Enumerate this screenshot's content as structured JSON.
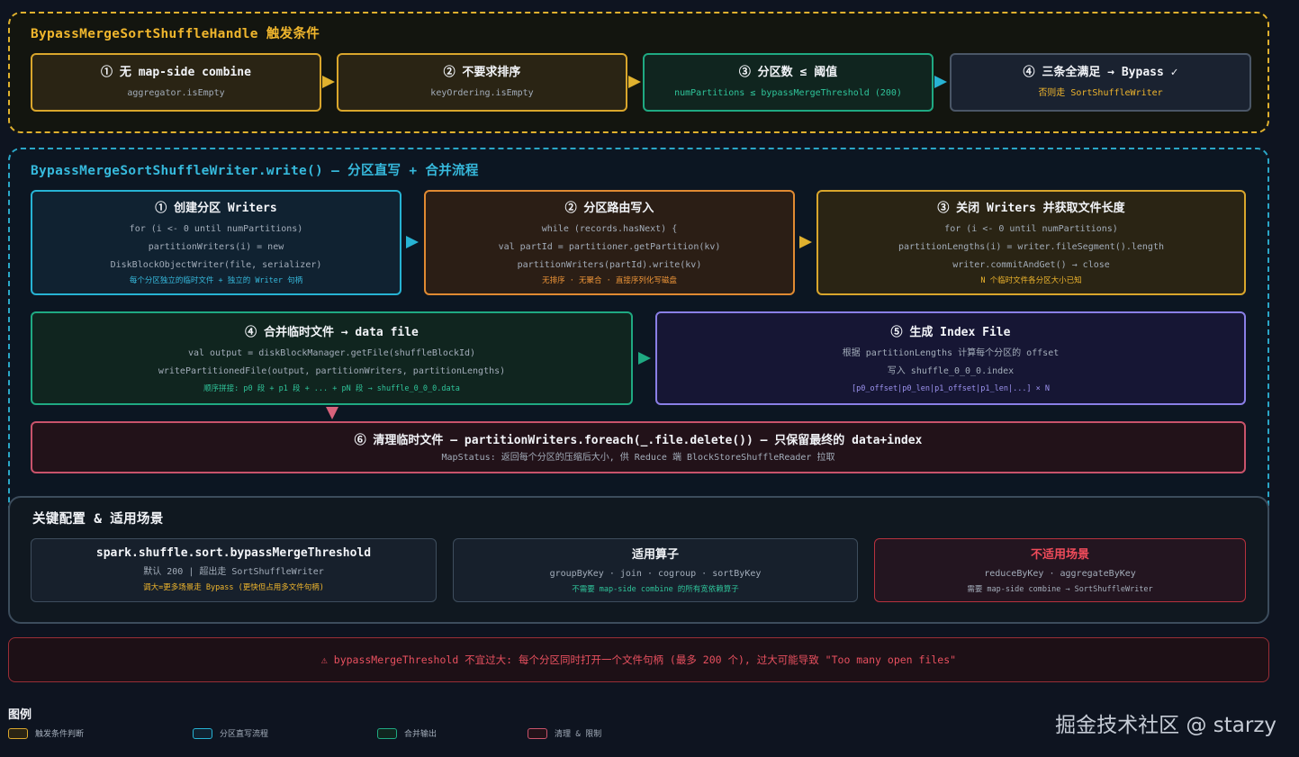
{
  "trigger": {
    "title": "BypassMergeSortShuffleHandle 触发条件",
    "boxes": [
      {
        "title": "① 无 map-side combine",
        "sub": "aggregator.isEmpty"
      },
      {
        "title": "② 不要求排序",
        "sub": "keyOrdering.isEmpty"
      },
      {
        "title": "③ 分区数 ≤ 阈值",
        "sub": "numPartitions ≤ bypassMergeThreshold (200)"
      },
      {
        "title": "④ 三条全满足 → Bypass ✓",
        "sub": "否则走 SortShuffleWriter"
      }
    ]
  },
  "flow": {
    "title": "BypassMergeSortShuffleWriter.write() — 分区直写 + 合并流程",
    "step1": {
      "title": "① 创建分区 Writers",
      "lines": [
        "for (i <- 0 until numPartitions)",
        "partitionWriters(i) = new",
        "DiskBlockObjectWriter(file, serializer)"
      ],
      "note": "每个分区独立的临时文件 + 独立的 Writer 句柄"
    },
    "step2": {
      "title": "② 分区路由写入",
      "lines": [
        "while (records.hasNext) {",
        "val partId = partitioner.getPartition(kv)",
        "partitionWriters(partId).write(kv)"
      ],
      "note": "无排序 · 无聚合 · 直接序列化写磁盘"
    },
    "step3": {
      "title": "③ 关闭 Writers 并获取文件长度",
      "lines": [
        "for (i <- 0 until numPartitions)",
        "partitionLengths(i) = writer.fileSegment().length",
        "writer.commitAndGet() → close"
      ],
      "note": "N 个临时文件各分区大小已知"
    },
    "step4": {
      "title": "④ 合并临时文件 → data file",
      "lines": [
        "val output = diskBlockManager.getFile(shuffleBlockId)",
        "writePartitionedFile(output, partitionWriters, partitionLengths)"
      ],
      "note": "顺序拼接: p0 段 + p1 段 + ... + pN 段 → shuffle_0_0_0.data"
    },
    "step5": {
      "title": "⑤ 生成 Index File",
      "lines": [
        "根据 partitionLengths 计算每个分区的 offset",
        "写入 shuffle_0_0_0.index"
      ],
      "note": "[p0_offset|p0_len|p1_offset|p1_len|...] × N"
    },
    "step6": {
      "title": "⑥ 清理临时文件 — partitionWriters.foreach(_.file.delete()) — 只保留最终的 data+index",
      "sub": "MapStatus: 返回每个分区的压缩后大小, 供 Reduce 端 BlockStoreShuffleReader 拉取"
    }
  },
  "config": {
    "title": "关键配置 & 适用场景",
    "cards": [
      {
        "title": "spark.shuffle.sort.bypassMergeThreshold",
        "sub": "默认 200 | 超出走 SortShuffleWriter",
        "note": "调大=更多场景走 Bypass (更快但占用多文件句柄)"
      },
      {
        "title": "适用算子",
        "sub": "groupByKey · join · cogroup · sortByKey",
        "note": "不需要 map-side combine 的所有宽依赖算子"
      },
      {
        "title": "不适用场景",
        "sub": "reduceByKey · aggregateByKey",
        "note": "需要 map-side combine → SortShuffleWriter"
      }
    ]
  },
  "warning": {
    "text": "⚠ bypassMergeThreshold 不宜过大: 每个分区同时打开一个文件句柄 (最多 200 个), 过大可能导致 \"Too many open files\""
  },
  "legend": {
    "title": "图例",
    "items": [
      {
        "label": "触发条件判断",
        "color": "#d9a62c"
      },
      {
        "label": "分区直写流程",
        "color": "#27b3d4"
      },
      {
        "label": "合并输出",
        "color": "#1fa982"
      },
      {
        "label": "清理 & 限制",
        "color": "#c9536b"
      }
    ]
  },
  "watermark": "掘金技术社区 @ starzy"
}
